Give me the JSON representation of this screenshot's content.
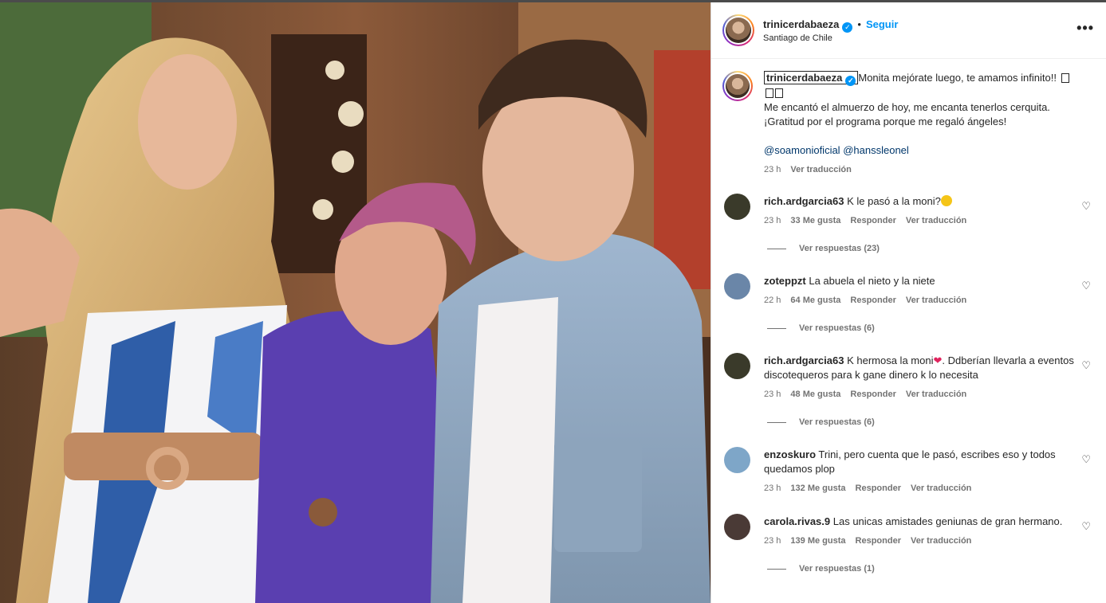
{
  "post": {
    "username": "trinicerdabaeza",
    "follow_label": "Seguir",
    "separator": "•",
    "location": "Santiago de Chile",
    "more_label": "•••"
  },
  "caption": {
    "username": "trinicerdabaeza",
    "line1": "Monita mejórate luego, te amamos infinito!!",
    "line2": "Me encantó el almuerzo de hoy, me encanta tenerlos cerquita.",
    "line3": "¡Gratitud por el programa porque me regaló ángeles!",
    "mention1": "@soamonioficial",
    "mention2": "@hanssleonel",
    "time": "23 h",
    "translate": "Ver traducción"
  },
  "comments": [
    {
      "username": "rich.ardgarcia63",
      "text": "K le pasó a la moni?",
      "time": "23 h",
      "likes": "33 Me gusta",
      "reply": "Responder",
      "translate": "Ver traducción",
      "replies": "Ver respuestas (23)",
      "avatar_color": "#3a3a2a"
    },
    {
      "username": "zoteppzt",
      "text": "La abuela el nieto y la niete",
      "time": "22 h",
      "likes": "64 Me gusta",
      "reply": "Responder",
      "translate": "Ver traducción",
      "replies": "Ver respuestas (6)",
      "avatar_color": "#6a86a8"
    },
    {
      "username": "rich.ardgarcia63",
      "text": "K hermosa la moni",
      "text2": ". Ddberían llevarla a eventos discotequeros para k gane dinero k lo necesita",
      "time": "23 h",
      "likes": "48 Me gusta",
      "reply": "Responder",
      "translate": "Ver traducción",
      "replies": "Ver respuestas (6)",
      "avatar_color": "#3a3a2a"
    },
    {
      "username": "enzoskuro",
      "text": "Trini, pero cuenta que le pasó, escribes eso y todos quedamos plop",
      "time": "23 h",
      "likes": "132 Me gusta",
      "reply": "Responder",
      "translate": "Ver traducción",
      "avatar_color": "#7ea6c8"
    },
    {
      "username": "carola.rivas.9",
      "text": "Las unicas amistades geniunas de gran hermano.",
      "time": "23 h",
      "likes": "139 Me gusta",
      "reply": "Responder",
      "translate": "Ver traducción",
      "replies": "Ver respuestas (1)",
      "avatar_color": "#4a3a36"
    }
  ],
  "icons": {
    "heart": "♡",
    "verified": "✓",
    "heart_emoji": "❤"
  }
}
